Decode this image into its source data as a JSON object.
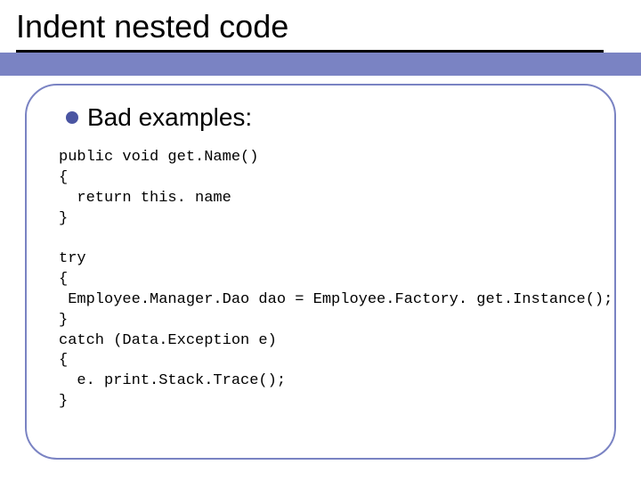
{
  "title": "Indent nested code",
  "heading": "Bad examples:",
  "code1": "public void get.Name()\n{\n  return this. name\n}",
  "code2": "try\n{\n Employee.Manager.Dao dao = Employee.Factory. get.Instance();\n}\ncatch (Data.Exception e)\n{\n  e. print.Stack.Trace();\n}"
}
